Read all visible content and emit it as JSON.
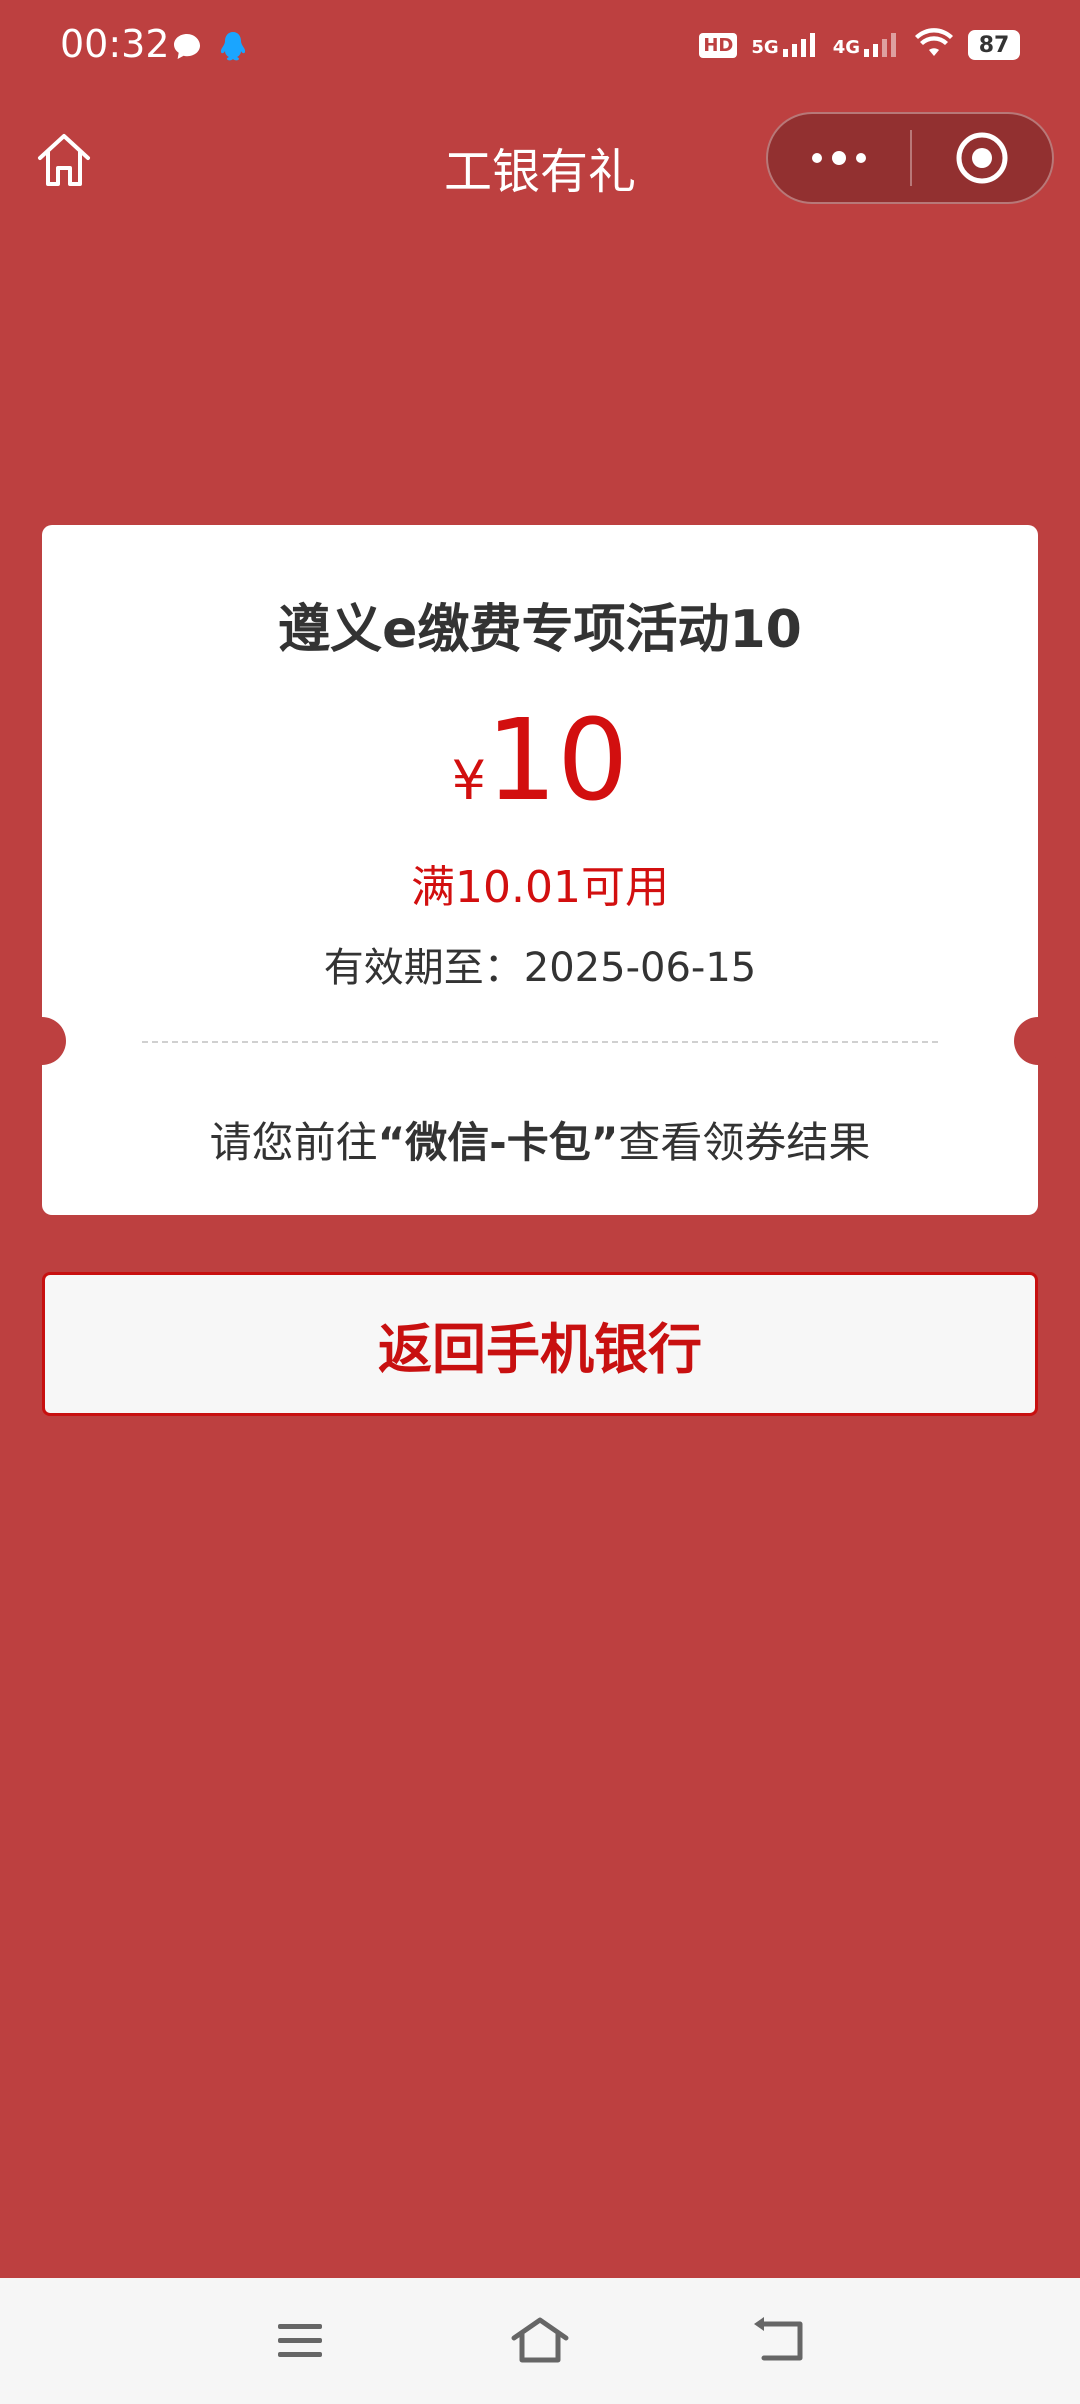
{
  "status_bar": {
    "time": "00:32",
    "hd_label": "HD",
    "net_5g": "5G",
    "net_4g": "4G",
    "battery": "87"
  },
  "nav": {
    "title": "工银有礼"
  },
  "coupon": {
    "title": "遵义e缴费专项活动10",
    "currency_symbol": "¥",
    "amount": "10",
    "condition": "满10.01可用",
    "validity_label": "有效期至：",
    "validity_date": "2025-06-15",
    "tip_prefix": "请您前往",
    "tip_highlight": "“微信-卡包”",
    "tip_suffix": "查看领券结果"
  },
  "actions": {
    "return_label": "返回手机银行"
  },
  "colors": {
    "background": "#bd4040",
    "accent_red": "#d20f0f",
    "card": "#ffffff"
  }
}
